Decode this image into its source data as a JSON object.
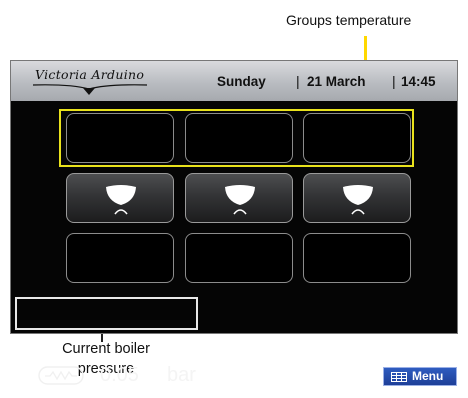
{
  "callouts": {
    "groups_temperature": "Groups temperature",
    "boiler_pressure_line1": "Current boiler",
    "boiler_pressure_line2": "pressure"
  },
  "header": {
    "logo_text": "Victoria Arduino",
    "day": "Sunday",
    "separator": "|",
    "date": "21 March",
    "time": "14:45"
  },
  "grid": {
    "temperature_row": [
      "",
      "",
      ""
    ],
    "cup_row_icons": [
      "cup-icon",
      "cup-icon",
      "cup-icon"
    ],
    "bottom_row": [
      "",
      "",
      ""
    ]
  },
  "footer": {
    "pressure_icon": "boiler-pressure-icon",
    "pressure_value": "0.05",
    "pressure_unit": "bar",
    "menu_label": "Menu",
    "menu_icon": "grid-icon"
  },
  "colors": {
    "highlight": "#e9e21c",
    "menu_button": "#2a52b4",
    "screen_background": "#050505",
    "header_bar": "#b9bcc1"
  }
}
